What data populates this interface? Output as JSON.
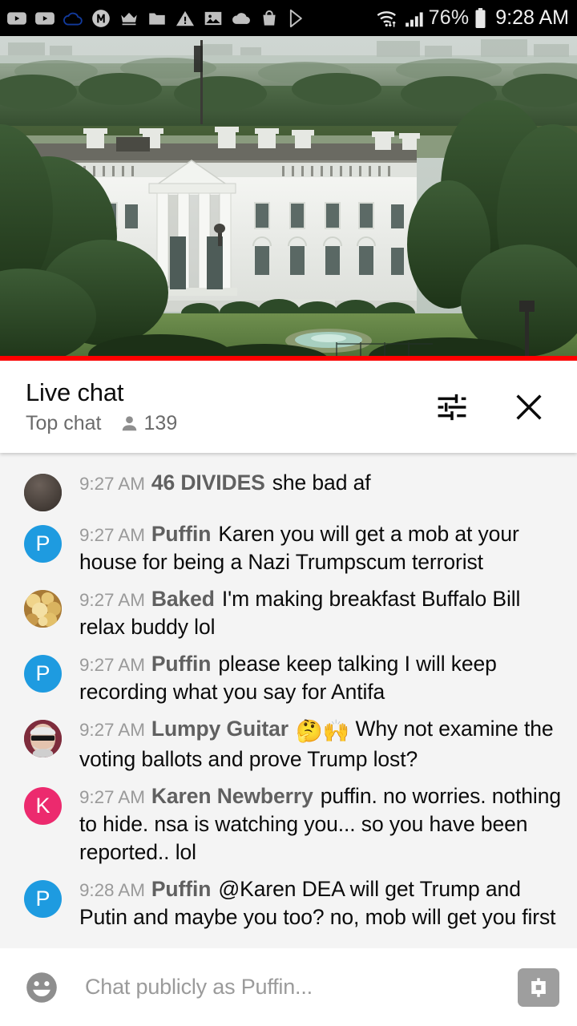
{
  "statusbar": {
    "icons": [
      {
        "name": "youtube-icon"
      },
      {
        "name": "youtube-icon"
      },
      {
        "name": "cloud-outline-icon"
      },
      {
        "name": "m-circle-icon"
      },
      {
        "name": "crown-icon"
      },
      {
        "name": "folder-icon"
      },
      {
        "name": "warning-triangle-icon"
      },
      {
        "name": "image-icon"
      },
      {
        "name": "cloud-icon"
      },
      {
        "name": "shopping-bag-icon"
      },
      {
        "name": "play-store-icon"
      }
    ],
    "wifi_icon": "wifi-data-icon",
    "signal_icon": "signal-bars-icon",
    "battery_percent": "76%",
    "battery_icon": "battery-icon",
    "time": "9:28 AM"
  },
  "video": {
    "name": "white-house-live-stream",
    "progress_color": "#ff0000",
    "progress_percent": 100
  },
  "chat_header": {
    "title": "Live chat",
    "mode": "Top chat",
    "viewers": "139",
    "viewers_icon": "person-icon",
    "settings_icon": "tune-sliders-icon",
    "close_icon": "close-x-icon"
  },
  "messages": [
    {
      "time": "9:27 AM",
      "author": "46 DIVIDES",
      "text": "she bad af",
      "avatar_type": "photo-dark",
      "avatar_color": "#4a423f",
      "avatar_letter": ""
    },
    {
      "time": "9:27 AM",
      "author": "Puffin",
      "text": "Karen you will get a mob at your house for being a Nazi Trumpscum terrorist",
      "avatar_type": "letter",
      "avatar_color": "#1e9be0",
      "avatar_letter": "P"
    },
    {
      "time": "9:27 AM",
      "author": "Baked",
      "text": "I'm making breakfast Buffalo Bill relax buddy lol",
      "avatar_type": "photo-food",
      "avatar_color": "#c89a4a",
      "avatar_letter": ""
    },
    {
      "time": "9:27 AM",
      "author": "Puffin",
      "text": "please keep talking I will keep recording what you say for Antifa",
      "avatar_type": "letter",
      "avatar_color": "#1e9be0",
      "avatar_letter": "P"
    },
    {
      "time": "9:27 AM",
      "author": "Lumpy Guitar",
      "emojis": "🤔🙌",
      "text": "Why not examine the voting ballots and prove Trump lost?",
      "avatar_type": "photo-person",
      "avatar_color": "#8a3a4a",
      "avatar_letter": ""
    },
    {
      "time": "9:27 AM",
      "author": "Karen Newberry",
      "text": "puffin. no worries. nothing to hide. nsa is watching you... so you have been reported.. lol",
      "avatar_type": "letter",
      "avatar_color": "#ec2a6e",
      "avatar_letter": "K"
    },
    {
      "time": "9:28 AM",
      "author": "Puffin",
      "text": "@Karen DEA will get Trump and Putin and maybe you too? no, mob will get you first",
      "avatar_type": "letter",
      "avatar_color": "#1e9be0",
      "avatar_letter": "P"
    }
  ],
  "input_bar": {
    "emoji_icon": "emoji-smiley-icon",
    "placeholder": "Chat publicly as Puffin...",
    "value": "",
    "superchat_icon": "dollar-superchat-icon"
  }
}
